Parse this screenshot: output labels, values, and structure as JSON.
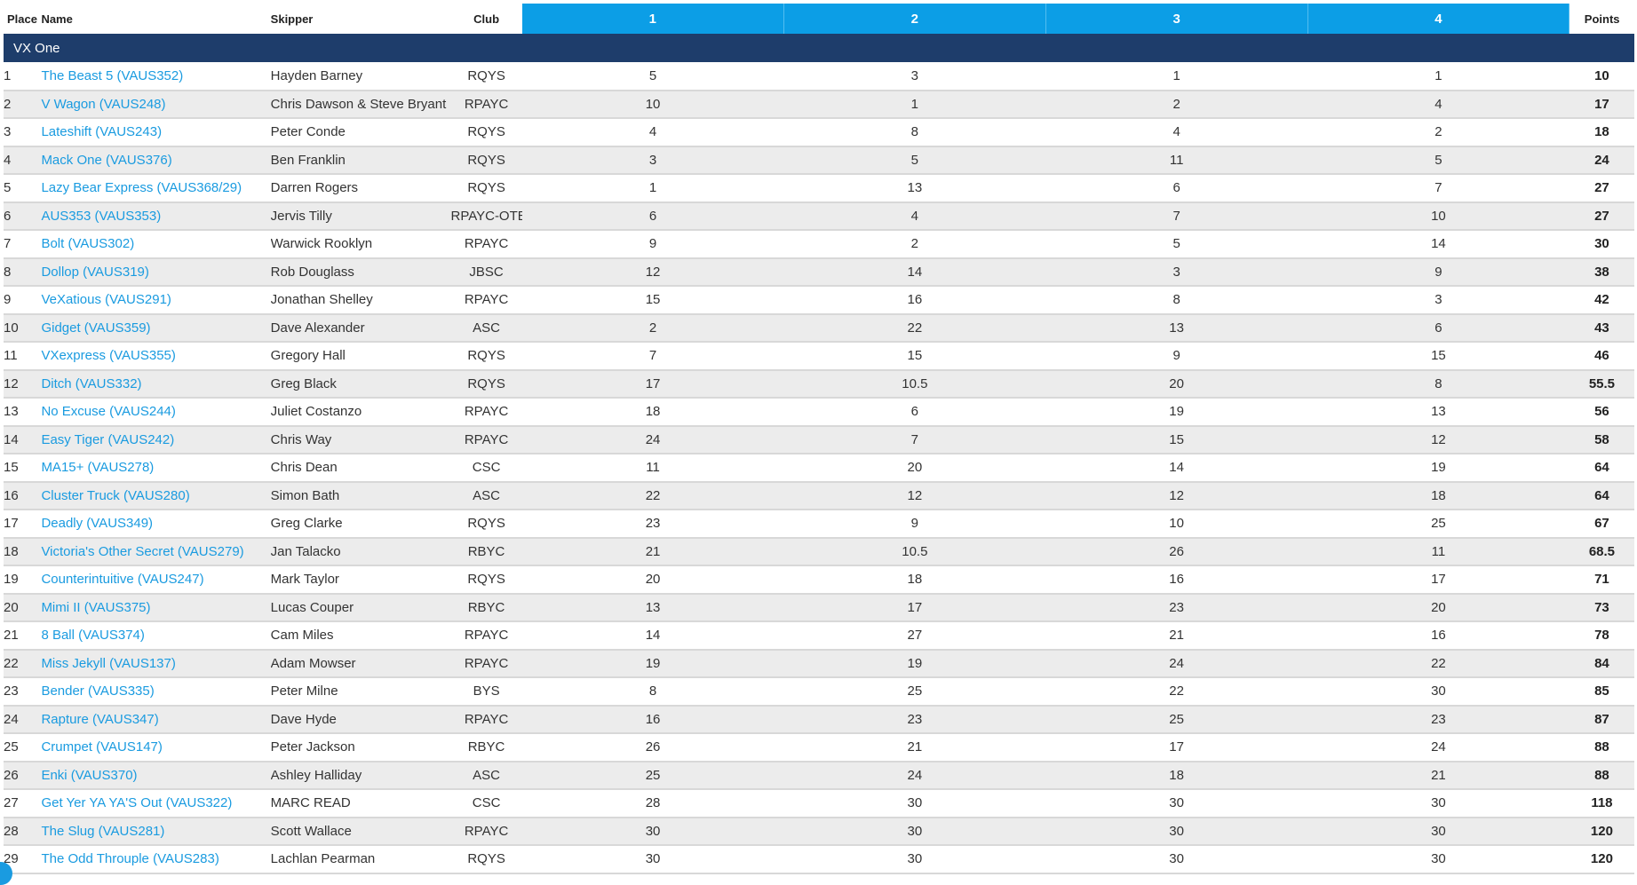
{
  "headers": {
    "place": "Place",
    "name": "Name",
    "skipper": "Skipper",
    "club": "Club",
    "races": [
      "1",
      "2",
      "3",
      "4"
    ],
    "points": "Points"
  },
  "group": {
    "label": "VX One"
  },
  "rows": [
    {
      "place": "1",
      "name": "The Beast 5 (VAUS352)",
      "skipper": "Hayden Barney",
      "club": "RQYS",
      "races": [
        "5",
        "3",
        "1",
        "1"
      ],
      "points": "10"
    },
    {
      "place": "2",
      "name": "V Wagon (VAUS248)",
      "skipper": "Chris Dawson & Steve Bryant",
      "club": "RPAYC",
      "races": [
        "10",
        "1",
        "2",
        "4"
      ],
      "points": "17"
    },
    {
      "place": "3",
      "name": "Lateshift (VAUS243)",
      "skipper": "Peter Conde",
      "club": "RQYS",
      "races": [
        "4",
        "8",
        "4",
        "2"
      ],
      "points": "18"
    },
    {
      "place": "4",
      "name": "Mack One (VAUS376)",
      "skipper": "Ben Franklin",
      "club": "RQYS",
      "races": [
        "3",
        "5",
        "11",
        "5"
      ],
      "points": "24"
    },
    {
      "place": "5",
      "name": "Lazy Bear Express (VAUS368/29)",
      "skipper": "Darren Rogers",
      "club": "RQYS",
      "races": [
        "1",
        "13",
        "6",
        "7"
      ],
      "points": "27"
    },
    {
      "place": "6",
      "name": "AUS353 (VAUS353)",
      "skipper": "Jervis Tilly",
      "club": "RPAYC-OTB",
      "races": [
        "6",
        "4",
        "7",
        "10"
      ],
      "points": "27"
    },
    {
      "place": "7",
      "name": "Bolt (VAUS302)",
      "skipper": "Warwick Rooklyn",
      "club": "RPAYC",
      "races": [
        "9",
        "2",
        "5",
        "14"
      ],
      "points": "30"
    },
    {
      "place": "8",
      "name": "Dollop (VAUS319)",
      "skipper": "Rob Douglass",
      "club": "JBSC",
      "races": [
        "12",
        "14",
        "3",
        "9"
      ],
      "points": "38"
    },
    {
      "place": "9",
      "name": "VeXatious (VAUS291)",
      "skipper": "Jonathan Shelley",
      "club": "RPAYC",
      "races": [
        "15",
        "16",
        "8",
        "3"
      ],
      "points": "42"
    },
    {
      "place": "10",
      "name": "Gidget (VAUS359)",
      "skipper": "Dave Alexander",
      "club": "ASC",
      "races": [
        "2",
        "22",
        "13",
        "6"
      ],
      "points": "43"
    },
    {
      "place": "11",
      "name": "VXexpress (VAUS355)",
      "skipper": "Gregory Hall",
      "club": "RQYS",
      "races": [
        "7",
        "15",
        "9",
        "15"
      ],
      "points": "46"
    },
    {
      "place": "12",
      "name": "Ditch (VAUS332)",
      "skipper": "Greg Black",
      "club": "RQYS",
      "races": [
        "17",
        "10.5",
        "20",
        "8"
      ],
      "points": "55.5"
    },
    {
      "place": "13",
      "name": "No Excuse (VAUS244)",
      "skipper": "Juliet Costanzo",
      "club": "RPAYC",
      "races": [
        "18",
        "6",
        "19",
        "13"
      ],
      "points": "56"
    },
    {
      "place": "14",
      "name": "Easy Tiger (VAUS242)",
      "skipper": "Chris Way",
      "club": "RPAYC",
      "races": [
        "24",
        "7",
        "15",
        "12"
      ],
      "points": "58"
    },
    {
      "place": "15",
      "name": "MA15+ (VAUS278)",
      "skipper": "Chris Dean",
      "club": "CSC",
      "races": [
        "11",
        "20",
        "14",
        "19"
      ],
      "points": "64"
    },
    {
      "place": "16",
      "name": "Cluster Truck (VAUS280)",
      "skipper": "Simon Bath",
      "club": "ASC",
      "races": [
        "22",
        "12",
        "12",
        "18"
      ],
      "points": "64"
    },
    {
      "place": "17",
      "name": "Deadly (VAUS349)",
      "skipper": "Greg Clarke",
      "club": "RQYS",
      "races": [
        "23",
        "9",
        "10",
        "25"
      ],
      "points": "67"
    },
    {
      "place": "18",
      "name": "Victoria's Other Secret (VAUS279)",
      "skipper": "Jan Talacko",
      "club": "RBYC",
      "races": [
        "21",
        "10.5",
        "26",
        "11"
      ],
      "points": "68.5"
    },
    {
      "place": "19",
      "name": "Counterintuitive (VAUS247)",
      "skipper": "Mark Taylor",
      "club": "RQYS",
      "races": [
        "20",
        "18",
        "16",
        "17"
      ],
      "points": "71"
    },
    {
      "place": "20",
      "name": "Mimi II (VAUS375)",
      "skipper": "Lucas Couper",
      "club": "RBYC",
      "races": [
        "13",
        "17",
        "23",
        "20"
      ],
      "points": "73"
    },
    {
      "place": "21",
      "name": "8 Ball (VAUS374)",
      "skipper": "Cam Miles",
      "club": "RPAYC",
      "races": [
        "14",
        "27",
        "21",
        "16"
      ],
      "points": "78"
    },
    {
      "place": "22",
      "name": "Miss Jekyll (VAUS137)",
      "skipper": "Adam Mowser",
      "club": "RPAYC",
      "races": [
        "19",
        "19",
        "24",
        "22"
      ],
      "points": "84"
    },
    {
      "place": "23",
      "name": "Bender (VAUS335)",
      "skipper": "Peter Milne",
      "club": "BYS",
      "races": [
        "8",
        "25",
        "22",
        "30"
      ],
      "points": "85"
    },
    {
      "place": "24",
      "name": "Rapture (VAUS347)",
      "skipper": "Dave Hyde",
      "club": "RPAYC",
      "races": [
        "16",
        "23",
        "25",
        "23"
      ],
      "points": "87"
    },
    {
      "place": "25",
      "name": "Crumpet (VAUS147)",
      "skipper": "Peter Jackson",
      "club": "RBYC",
      "races": [
        "26",
        "21",
        "17",
        "24"
      ],
      "points": "88"
    },
    {
      "place": "26",
      "name": "Enki (VAUS370)",
      "skipper": "Ashley Halliday",
      "club": "ASC",
      "races": [
        "25",
        "24",
        "18",
        "21"
      ],
      "points": "88"
    },
    {
      "place": "27",
      "name": "Get Yer YA YA'S Out (VAUS322)",
      "skipper": "MARC READ",
      "club": "CSC",
      "races": [
        "28",
        "30",
        "30",
        "30"
      ],
      "points": "118"
    },
    {
      "place": "28",
      "name": "The Slug (VAUS281)",
      "skipper": "Scott Wallace",
      "club": "RPAYC",
      "races": [
        "30",
        "30",
        "30",
        "30"
      ],
      "points": "120"
    },
    {
      "place": "29",
      "name": "The Odd Throuple (VAUS283)",
      "skipper": "Lachlan Pearman",
      "club": "RQYS",
      "races": [
        "30",
        "30",
        "30",
        "30"
      ],
      "points": "120"
    }
  ]
}
